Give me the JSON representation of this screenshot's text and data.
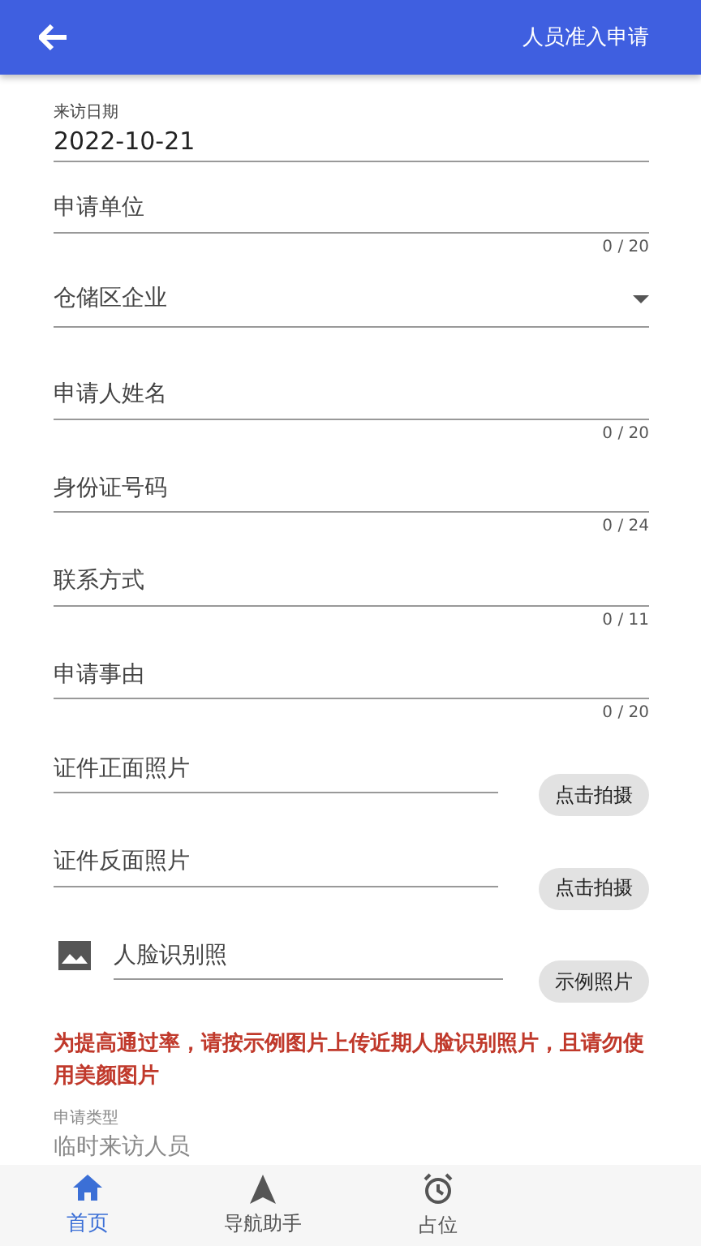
{
  "header": {
    "title": "人员准入申请"
  },
  "visit_date": {
    "label": "来访日期",
    "value": "2022-10-21"
  },
  "fields": [
    {
      "kind": "text",
      "placeholder": "申请单位",
      "counter": "0 / 20"
    },
    {
      "kind": "select",
      "placeholder": "仓储区企业"
    },
    {
      "kind": "text",
      "placeholder": "申请人姓名",
      "counter": "0 / 20"
    },
    {
      "kind": "text",
      "placeholder": "身份证号码",
      "counter": "0 / 24"
    },
    {
      "kind": "text",
      "placeholder": "联系方式",
      "counter": "0 / 11"
    },
    {
      "kind": "text",
      "placeholder": "申请事由",
      "counter": "0 / 20"
    },
    {
      "kind": "photo",
      "placeholder": "证件正面照片",
      "button": "点击拍摄"
    },
    {
      "kind": "photo",
      "placeholder": "证件反面照片",
      "button": "点击拍摄"
    },
    {
      "kind": "face",
      "placeholder": "人脸识别照",
      "button": "示例照片"
    }
  ],
  "warning": "为提高通过率，请按示例图片上传近期人脸识别照片，且请勿使用美颜图片",
  "apply_type": {
    "label": "申请类型",
    "value": "临时来访人员"
  },
  "nav": [
    {
      "kind": "home",
      "label": "首页",
      "selected": true
    },
    {
      "kind": "navigate",
      "label": "导航助手",
      "selected": false
    },
    {
      "kind": "alarm",
      "label": "占位",
      "selected": false
    }
  ]
}
